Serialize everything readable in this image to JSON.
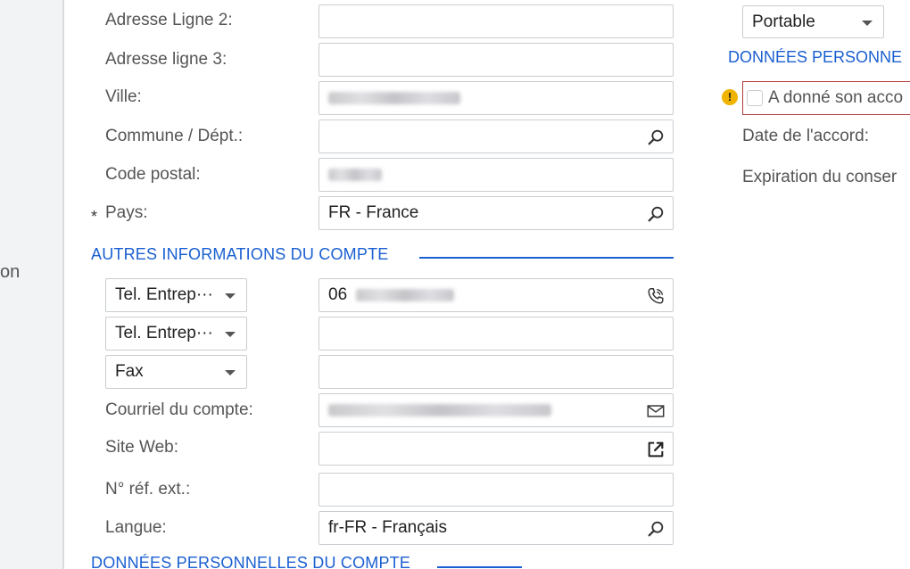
{
  "left_rail": {
    "partial_text": "on"
  },
  "form": {
    "address_line2": {
      "label": "Adresse Ligne 2:",
      "value": ""
    },
    "address_line3": {
      "label": "Adresse ligne 3:",
      "value": ""
    },
    "city": {
      "label": "Ville:"
    },
    "commune": {
      "label": "Commune / Dépt.:",
      "value": ""
    },
    "postal_code": {
      "label": "Code postal:"
    },
    "country": {
      "label": "Pays:",
      "required_mark": "*",
      "value": "FR - France"
    }
  },
  "account_info": {
    "section_title": "AUTRES INFORMATIONS DU COMPTE",
    "phone1": {
      "type": "Tel. Entrep···",
      "value_prefix": "06"
    },
    "phone2": {
      "type": "Tel. Entrep···",
      "value": ""
    },
    "fax": {
      "type": "Fax",
      "value": ""
    },
    "email": {
      "label": "Courriel du compte:"
    },
    "website": {
      "label": "Site Web:",
      "value": ""
    },
    "ext_ref": {
      "label": "N° réf. ext.:",
      "value": ""
    },
    "language": {
      "label": "Langue:",
      "value": "fr-FR - Français"
    }
  },
  "personal_data_bottom": {
    "section_title": "DONNÉES PERSONNELLES DU COMPTE"
  },
  "right_panel": {
    "phone_type_value": "Portable",
    "section_title": "DONNÉES PERSONNE",
    "consent_label": "A donné son acco",
    "consent_date_label": "Date de l'accord:",
    "consent_expiry_label": "Expiration du conser"
  },
  "colors": {
    "accent": "#1a5fd1",
    "error_border": "#b23b3b",
    "warning": "#f0b400"
  }
}
